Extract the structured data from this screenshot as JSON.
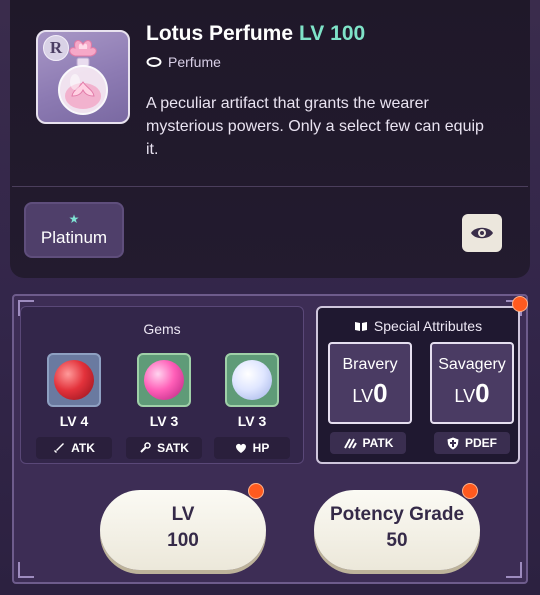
{
  "item": {
    "name": "Lotus Perfume",
    "level": "LV 100",
    "type": "Perfume",
    "rank": "R",
    "description": "A peculiar artifact that grants the wearer mysterious powers. Only a select few can equip it.",
    "rarity_star": "★",
    "rarity": "Platinum"
  },
  "gems": {
    "title": "Gems",
    "items": [
      {
        "color": "red",
        "level": "LV 4",
        "stat": "ATK",
        "icon": "sword-icon"
      },
      {
        "color": "pink",
        "level": "LV 3",
        "stat": "SATK",
        "icon": "wand-icon"
      },
      {
        "color": "white",
        "level": "LV 3",
        "stat": "HP",
        "icon": "heart-icon"
      }
    ]
  },
  "special": {
    "title": "Special Attributes",
    "attributes": [
      {
        "name": "Bravery",
        "lv_prefix": "LV",
        "lv_value": "0",
        "stat": "PATK",
        "icon": "claw-icon"
      },
      {
        "name": "Savagery",
        "lv_prefix": "LV",
        "lv_value": "0",
        "stat": "PDEF",
        "icon": "shield-cross-icon"
      }
    ]
  },
  "buttons": {
    "lv_label": "LV",
    "lv_value": "100",
    "potency_label": "Potency Grade",
    "potency_value": "50"
  },
  "colors": {
    "accent_level": "#7fe3c8",
    "notification": "#ff5a1f",
    "panel_dark": "#1f1829"
  }
}
